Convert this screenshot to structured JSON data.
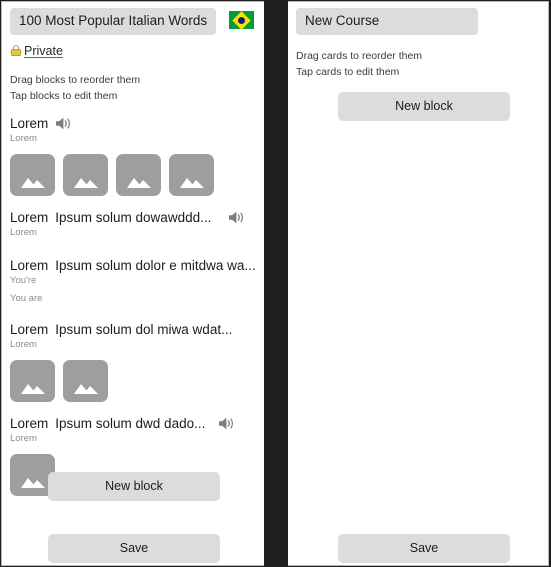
{
  "left_panel": {
    "title_value": "100 Most Popular Italian Words",
    "flag_icon": "brazil-flag-icon",
    "visibility": {
      "icon": "lock-icon",
      "label": "Private"
    },
    "hints": [
      "Drag blocks to reorder them",
      "Tap blocks to edit them"
    ],
    "blocks": [
      {
        "word": "Lorem",
        "phrase": "",
        "speaker": true,
        "subs": [
          "Lorem"
        ],
        "thumbs": 4
      },
      {
        "word": "Lorem",
        "phrase": "Ipsum solum dowawddd...",
        "speaker": true,
        "subs": [
          "Lorem"
        ],
        "thumbs": 0
      },
      {
        "word": "Lorem",
        "phrase": "Ipsum solum dolor e mitdwa wa...",
        "speaker": true,
        "subs": [
          "You're",
          "You are"
        ],
        "thumbs": 0
      },
      {
        "word": "Lorem",
        "phrase": "Ipsum solum dol miwa wdat...",
        "speaker": false,
        "subs": [
          "Lorem"
        ],
        "thumbs": 2
      },
      {
        "word": "Lorem",
        "phrase": "Ipsum solum dwd dado...",
        "speaker": true,
        "subs": [
          "Lorem"
        ],
        "thumbs": 1
      }
    ],
    "new_block_label": "New block",
    "save_label": "Save"
  },
  "right_panel": {
    "title_value": "New Course",
    "hints": [
      "Drag cards to reorder them",
      "Tap cards to edit them"
    ],
    "new_block_label": "New block",
    "save_label": "Save"
  },
  "colors": {
    "field_bg": "#dcdcdc",
    "thumb_gray": "#9e9e9e",
    "divider": "#1e1e1e",
    "flag_green": "#009b3a",
    "flag_yellow": "#ffdf00",
    "flag_blue": "#002776",
    "link_underline": "#3b63c8"
  }
}
